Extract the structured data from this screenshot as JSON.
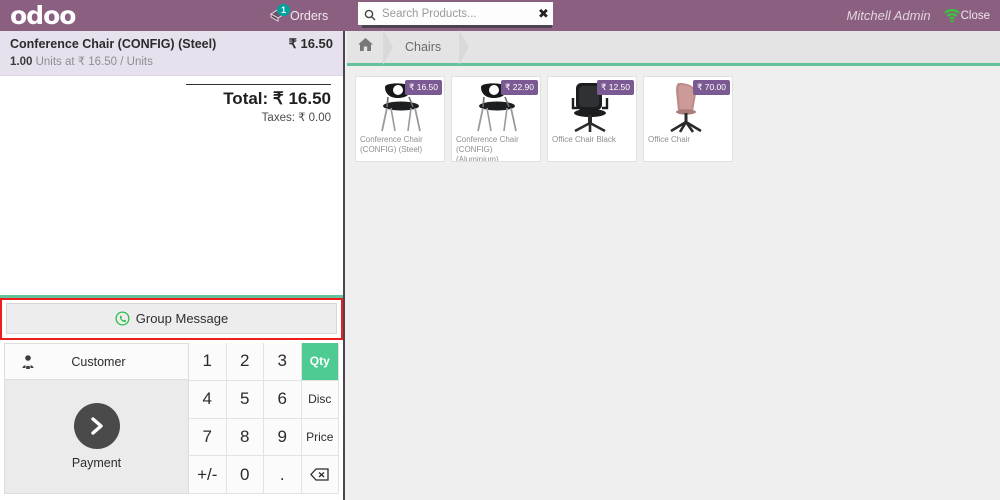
{
  "app": {
    "brand": "odoo",
    "accent_purple": "#8a5f80",
    "accent_green": "#64c39a",
    "highlight_red": "#f01d1d"
  },
  "topbar": {
    "orders_label": "Orders",
    "orders_count": "1",
    "orders_icon": "ticket-icon",
    "user_name": "Mitchell Admin",
    "close_label": "Close",
    "wifi_icon": "wifi-icon"
  },
  "search": {
    "placeholder": "Search Products...",
    "value": "",
    "icon": "search-icon",
    "clear_icon": "close-icon"
  },
  "order": {
    "lines": [
      {
        "name": "Conference Chair (CONFIG) (Steel)",
        "qty": "1.00",
        "unit_text": "Units at ₹ 16.50 / Units",
        "price": "₹ 16.50"
      }
    ],
    "total_label": "Total: ₹ 16.50",
    "taxes_label": "Taxes: ₹ 0.00"
  },
  "group_message": {
    "label": "Group Message",
    "icon": "whatsapp-icon"
  },
  "pad": {
    "customer_label": "Customer",
    "customer_icon": "user-icon",
    "payment_label": "Payment",
    "payment_icon": "chevron-right-icon",
    "keys": [
      {
        "label": "1",
        "kind": "digit"
      },
      {
        "label": "2",
        "kind": "digit"
      },
      {
        "label": "3",
        "kind": "digit"
      },
      {
        "label": "Qty",
        "kind": "mode",
        "active": true
      },
      {
        "label": "4",
        "kind": "digit"
      },
      {
        "label": "5",
        "kind": "digit"
      },
      {
        "label": "6",
        "kind": "digit"
      },
      {
        "label": "Disc",
        "kind": "mode",
        "active": false
      },
      {
        "label": "7",
        "kind": "digit"
      },
      {
        "label": "8",
        "kind": "digit"
      },
      {
        "label": "9",
        "kind": "digit"
      },
      {
        "label": "Price",
        "kind": "mode",
        "active": false
      },
      {
        "label": "+/-",
        "kind": "digit"
      },
      {
        "label": "0",
        "kind": "digit"
      },
      {
        "label": ".",
        "kind": "digit"
      },
      {
        "label": "",
        "kind": "backspace"
      }
    ]
  },
  "breadcrumb": {
    "home_icon": "home-icon",
    "items": [
      "Chairs"
    ]
  },
  "products": [
    {
      "name": "Conference Chair (CONFIG) (Steel)",
      "price": "₹ 16.50",
      "image": "conference-chair-steel"
    },
    {
      "name": "Conference Chair (CONFIG) (Aluminium)",
      "price": "₹ 22.90",
      "image": "conference-chair-aluminium"
    },
    {
      "name": "Office Chair Black",
      "price": "₹ 12.50",
      "image": "office-chair-black"
    },
    {
      "name": "Office Chair",
      "price": "₹ 70.00",
      "image": "office-chair-pink"
    }
  ]
}
